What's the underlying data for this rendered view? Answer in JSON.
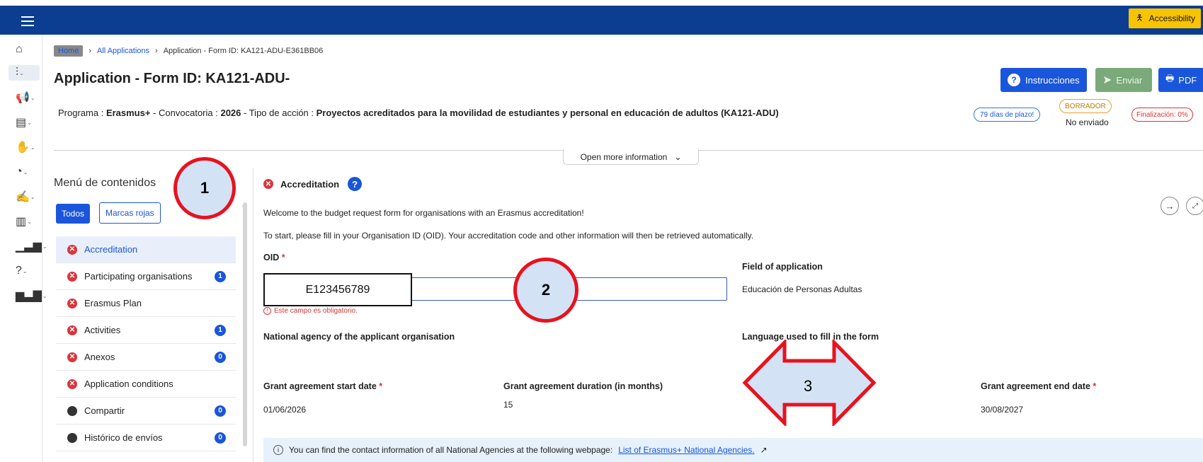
{
  "topbar": {
    "accessibility_label": "Accessibility"
  },
  "rail": {
    "icons": [
      "home-icon",
      "sliders-icon",
      "megaphone-icon",
      "document-icon",
      "hand-icon",
      "dashboard-icon",
      "sign-icon",
      "building-icon",
      "bar-chart-icon",
      "help-icon",
      "report-icon"
    ]
  },
  "breadcrumb": {
    "home": "Home",
    "all_applications": "All Applications",
    "current": "Application - Form ID: KA121-ADU-E361BB06"
  },
  "header": {
    "title": "Application - Form ID: KA121-ADU-",
    "instrucciones_label": "Instrucciones",
    "enviar_label": "Enviar",
    "pdf_label": "PDF",
    "programa_prefix": "Programa :",
    "programa_value": "Erasmus+",
    "convocatoria_prefix": "- Convocatoria :",
    "convocatoria_value": "2026",
    "tipo_prefix": "- Tipo de acción :",
    "tipo_value": "Proyectos acreditados para la movilidad de estudiantes y personal en educación de adultos (KA121-ADU)",
    "plazo_badge": "79 días de plazo!",
    "borrador_badge": "BORRADOR",
    "no_enviado": "No enviado",
    "finalizacion_badge": "Finalización: 0%",
    "open_more": "Open more information"
  },
  "menu": {
    "title": "Menú de contenidos",
    "filter_all": "Todos",
    "filter_red": "Marcas rojas",
    "items": [
      {
        "label": "Accreditation",
        "status": "error",
        "count": ""
      },
      {
        "label": "Participating organisations",
        "status": "error",
        "count": "1"
      },
      {
        "label": "Erasmus Plan",
        "status": "error",
        "count": ""
      },
      {
        "label": "Activities",
        "status": "error",
        "count": "1"
      },
      {
        "label": "Anexos",
        "status": "error",
        "count": "0"
      },
      {
        "label": "Application conditions",
        "status": "error",
        "count": ""
      },
      {
        "label": "Compartir",
        "status": "neutral",
        "count": "0"
      },
      {
        "label": "Histórico de envíos",
        "status": "neutral",
        "count": "0"
      }
    ]
  },
  "main": {
    "section_title": "Accreditation",
    "welcome": "Welcome to the budget request form for organisations with an Erasmus accreditation!",
    "instructions": "To start, please fill in your Organisation ID (OID). Your accreditation code and other information will then be retrieved automatically.",
    "oid_label": "OID",
    "oid_value": "E123456789",
    "oid_error": "Este campo es obligatorio.",
    "field_app_label": "Field of application",
    "field_app_value": "Educación de Personas Adultas",
    "national_agency_label": "National agency of the applicant organisation",
    "language_label": "Language used to fill in the form",
    "start_label": "Grant agreement start date",
    "start_value": "01/06/2026",
    "duration_label": "Grant agreement duration (in months)",
    "duration_value": "15",
    "end_label": "Grant agreement end date",
    "end_value": "30/08/2027",
    "info_text": "You can find the contact information of all National Agencies at the following webpage:",
    "info_link": "List of Erasmus+ National Agencies."
  },
  "annotations": {
    "callout_1": "1",
    "callout_2": "2",
    "arrow_3": "3"
  },
  "colors": {
    "topbar": "#0b3e91",
    "primary": "#1a56db",
    "error": "#d9363e",
    "annotation_red": "#e8121e",
    "annotation_fill": "#d3e3f5"
  }
}
